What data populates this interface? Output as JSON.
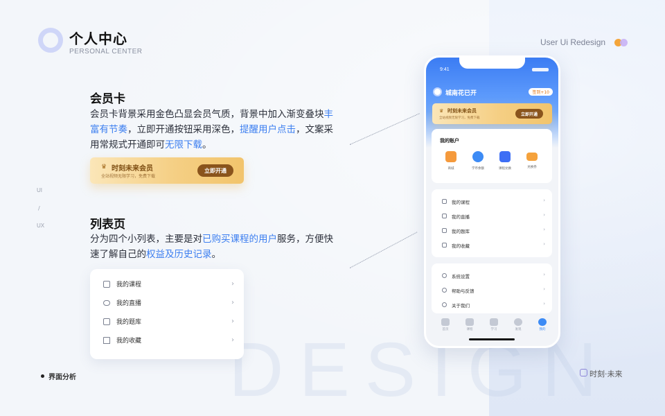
{
  "header": {
    "title_cn": "个人中心",
    "title_en": "PERSONAL CENTER",
    "redesign_label": "User Ui Redesign"
  },
  "side": {
    "ui": "UI",
    "slash": "/",
    "ux": "UX"
  },
  "member_section": {
    "title": "会员卡",
    "desc_1": "会员卡背景采用金色凸显会员气质，背景中加入渐变叠块",
    "desc_hl_1": "丰富有节奏",
    "desc_2": "，立即开通按钮采用深色，",
    "desc_hl_2": "提醒用户点击",
    "desc_3": "，文案采用常规式开通即可",
    "desc_hl_3": "无限下载",
    "desc_4": "。"
  },
  "vip_card": {
    "title": "时刻未来会员",
    "subtitle": "全站视频无限学习，免费下载",
    "button": "立即开通"
  },
  "list_section": {
    "title": "列表页",
    "desc_1": "分为四个小列表，主要是对",
    "desc_hl_1": "已购买课程的用户",
    "desc_2": "服务，方便快速了解自己的",
    "desc_hl_2": "权益及历史记录",
    "desc_3": "。"
  },
  "list_items": [
    {
      "label": "我的课程"
    },
    {
      "label": "我的直播"
    },
    {
      "label": "我的题库"
    },
    {
      "label": "我的收藏"
    }
  ],
  "footer": {
    "left": "界面分析",
    "right": "时刻·未来"
  },
  "watermark": "DESIGN",
  "phone": {
    "time": "9:41",
    "username": "城南花已开",
    "sign_badge": "签到+10",
    "vip_title": "时刻未来会员",
    "vip_subtitle": "全站视频无限学习，免费下载",
    "vip_button": "立即开通",
    "account_title": "我的账户",
    "account_items": [
      {
        "label": "商城",
        "color": "#f59a3c"
      },
      {
        "label": "学币余额",
        "color": "#3d8bf5"
      },
      {
        "label": "课程兑换",
        "color": "#3d6ef5"
      },
      {
        "label": "兑换券",
        "color": "#f5a23c"
      }
    ],
    "list_items": [
      {
        "label": "我的课程"
      },
      {
        "label": "我的直播"
      },
      {
        "label": "我的题库"
      },
      {
        "label": "我的收藏"
      }
    ],
    "settings_items": [
      {
        "label": "系统设置"
      },
      {
        "label": "帮助与反馈"
      },
      {
        "label": "关于我们"
      }
    ],
    "tabs": [
      {
        "label": "首页"
      },
      {
        "label": "课程"
      },
      {
        "label": "学习"
      },
      {
        "label": "发现"
      },
      {
        "label": "我的"
      }
    ]
  }
}
